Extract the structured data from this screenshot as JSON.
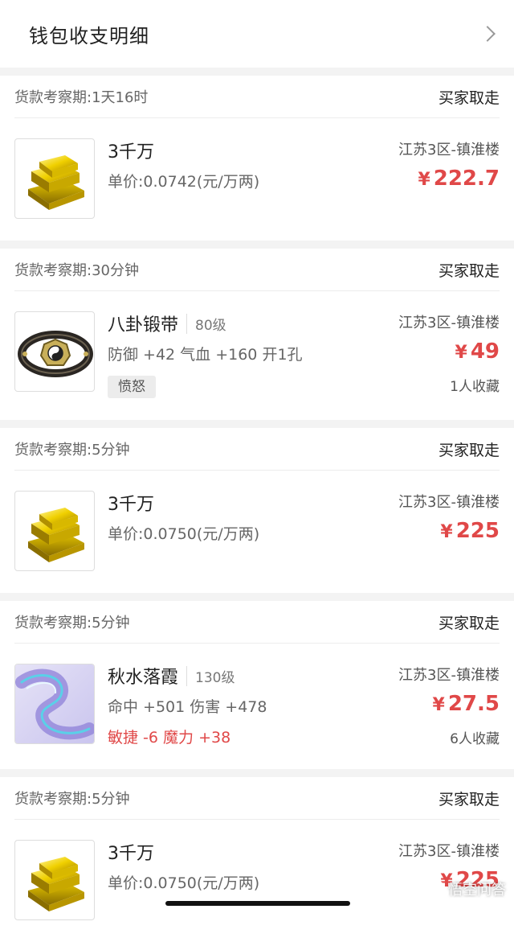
{
  "header": {
    "title": "钱包收支明细"
  },
  "cards": [
    {
      "period": "货款考察期:1天16时",
      "status": "买家取走",
      "name": "3千万",
      "level": "",
      "line2": "单价:0.0742(元/万两)",
      "line3": "",
      "server": "江苏3区-镇淮楼",
      "currency": "¥",
      "price": "222.7",
      "favs": "",
      "icon": "gold-ingot-icon"
    },
    {
      "period": "货款考察期:30分钟",
      "status": "买家取走",
      "name": "八卦锻带",
      "level": "80级",
      "line2": "防御 +42 气血 +160 开1孔",
      "line3": "愤怒",
      "server": "江苏3区-镇淮楼",
      "currency": "¥",
      "price": "49",
      "favs": "1人收藏",
      "icon": "bagua-belt-icon"
    },
    {
      "period": "货款考察期:5分钟",
      "status": "买家取走",
      "name": "3千万",
      "level": "",
      "line2": "单价:0.0750(元/万两)",
      "line3": "",
      "server": "江苏3区-镇淮楼",
      "currency": "¥",
      "price": "225",
      "favs": "",
      "icon": "gold-ingot-icon"
    },
    {
      "period": "货款考察期:5分钟",
      "status": "买家取走",
      "name": "秋水落霞",
      "level": "130级",
      "line2": "命中 +501 伤害 +478",
      "line3": "敏捷 -6 魔力 +38",
      "server": "江苏3区-镇淮楼",
      "currency": "¥",
      "price": "27.5",
      "favs": "6人收藏",
      "icon": "ribbon-icon"
    },
    {
      "period": "货款考察期:5分钟",
      "status": "买家取走",
      "name": "3千万",
      "level": "",
      "line2": "单价:0.0750(元/万两)",
      "line3": "",
      "server": "江苏3区-镇淮楼",
      "currency": "¥",
      "price": "225",
      "favs": "",
      "icon": "gold-ingot-icon"
    }
  ],
  "watermark": "悟空问答"
}
